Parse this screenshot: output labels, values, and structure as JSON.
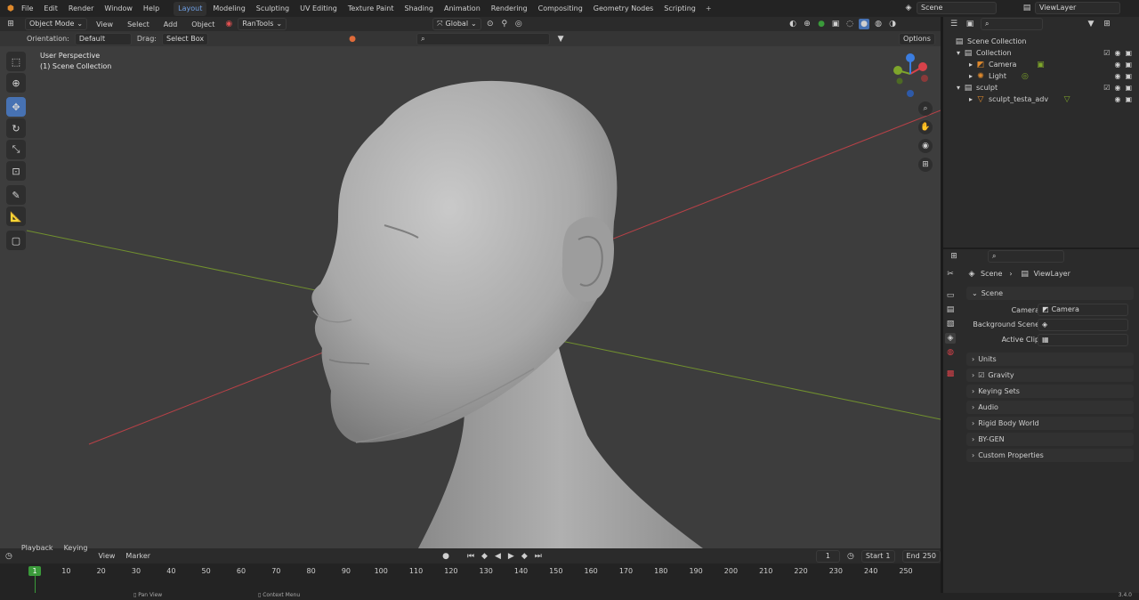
{
  "topbar": {
    "menus": [
      "File",
      "Edit",
      "Render",
      "Window",
      "Help"
    ],
    "workspaces": [
      "Layout",
      "Modeling",
      "Sculpting",
      "UV Editing",
      "Texture Paint",
      "Shading",
      "Animation",
      "Rendering",
      "Compositing",
      "Geometry Nodes",
      "Scripting"
    ],
    "active_workspace": "Layout",
    "scene_label": "Scene",
    "viewlayer_label": "ViewLayer"
  },
  "viewport_header": {
    "mode": "Object Mode",
    "menus": [
      "View",
      "Select",
      "Add",
      "Object"
    ],
    "addon": "RanTools",
    "transform": "Global",
    "orientation_label": "Orientation:",
    "orientation_value": "Default",
    "drag_label": "Drag:",
    "drag_value": "Select Box",
    "options_label": "Options"
  },
  "viewport": {
    "perspective_text": "User Perspective",
    "collection_text": "(1) Scene Collection",
    "gizmo_axes": [
      "X",
      "Y",
      "Z"
    ]
  },
  "outliner": {
    "root": "Scene Collection",
    "items": [
      {
        "label": "Collection",
        "level": 1
      },
      {
        "label": "Camera",
        "level": 2
      },
      {
        "label": "Light",
        "level": 2
      },
      {
        "label": "sculpt",
        "level": 1
      },
      {
        "label": "sculpt_testa_adv",
        "level": 2
      }
    ]
  },
  "properties": {
    "breadcrumb_scene": "Scene",
    "breadcrumb_viewlayer": "ViewLayer",
    "section_scene": "Scene",
    "camera_label": "Camera",
    "camera_value": "Camera",
    "background_scene_label": "Background Scene",
    "active_clip_label": "Active Clip",
    "sections": [
      "Units",
      "Gravity",
      "Keying Sets",
      "Audio",
      "Rigid Body World",
      "BY-GEN",
      "Custom Properties"
    ]
  },
  "timeline": {
    "menus": [
      "Playback",
      "Keying",
      "View",
      "Marker"
    ],
    "current_frame": "1",
    "start_label": "Start",
    "start_value": "1",
    "end_label": "End",
    "end_value": "250",
    "ruler": [
      "1",
      "10",
      "20",
      "30",
      "40",
      "50",
      "60",
      "70",
      "80",
      "90",
      "100",
      "110",
      "120",
      "130",
      "140",
      "150",
      "160",
      "170",
      "180",
      "190",
      "200",
      "210",
      "220",
      "230",
      "240",
      "250"
    ],
    "ruler_min": 1,
    "ruler_max": 250
  },
  "statusbar": {
    "pan_view": "Pan View",
    "context_menu": "Context Menu",
    "version": "3.4.0"
  },
  "colors": {
    "accent": "#4772b3",
    "active_tab_text": "#6fa0e6",
    "viewport_bg": "#3d3d3d",
    "panel_bg": "#2b2b2b",
    "x_axis": "#d8424a",
    "y_axis": "#7ea52b",
    "z_axis": "#3b7de0",
    "playhead": "#3a9a3a"
  }
}
